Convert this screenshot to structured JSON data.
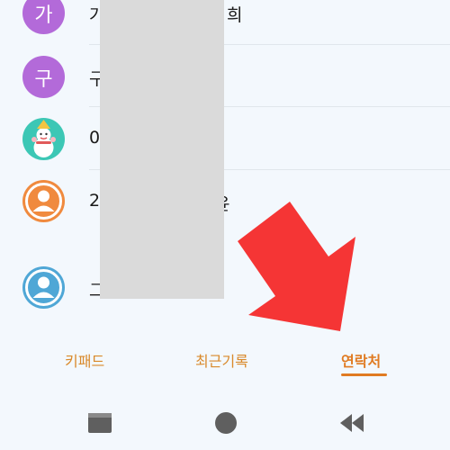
{
  "contacts": [
    {
      "avatar_text": "가",
      "avatar_color": "#b36ad9",
      "name": "가",
      "name_tail": "희"
    },
    {
      "avatar_text": "구",
      "avatar_color": "#b36ad9",
      "name": "구"
    },
    {
      "avatar_icon": "snowman-icon",
      "avatar_color": "#3cc7b5",
      "name": "0"
    },
    {
      "avatar_icon": "person-icon",
      "avatar_color": "#f08a3e",
      "name": "2",
      "name_tail": "윤"
    },
    {
      "avatar_icon": "person-icon",
      "avatar_color": "#4fa7d6",
      "name": "그"
    }
  ],
  "tabs": {
    "keypad": "키패드",
    "recent": "최근기록",
    "contacts": "연락처",
    "active": "contacts",
    "accent_color": "#e07b22"
  },
  "navbar": {
    "recent_apps": "recent-apps-icon",
    "home": "home-icon",
    "back": "back-icon"
  },
  "annotation": {
    "arrow_color": "#f53535"
  }
}
